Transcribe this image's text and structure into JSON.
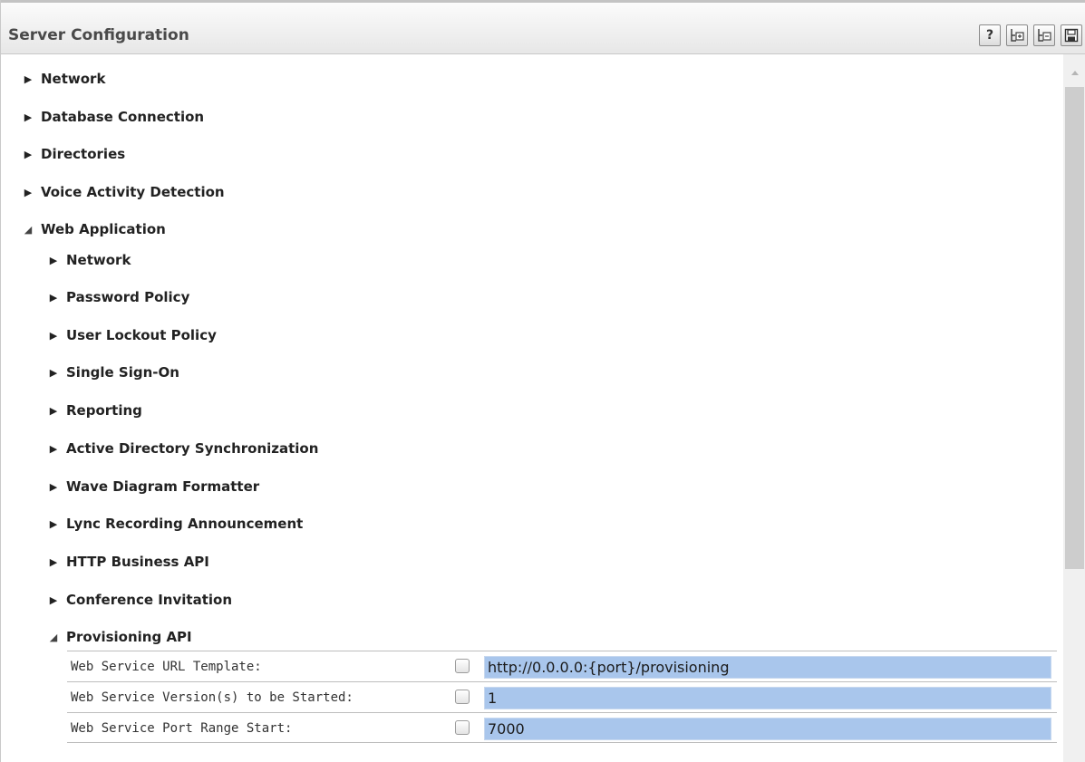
{
  "header": {
    "title": "Server Configuration",
    "buttons": [
      {
        "name": "help-button",
        "icon": "help-icon",
        "glyph": "?"
      },
      {
        "name": "expand-all-button",
        "icon": "expand-all-icon"
      },
      {
        "name": "collapse-all-button",
        "icon": "collapse-all-icon"
      },
      {
        "name": "save-button",
        "icon": "save-icon"
      }
    ]
  },
  "tree": {
    "top_level": [
      {
        "label": "Network",
        "expanded": false
      },
      {
        "label": "Database Connection",
        "expanded": false
      },
      {
        "label": "Directories",
        "expanded": false
      },
      {
        "label": "Voice Activity Detection",
        "expanded": false
      },
      {
        "label": "Web Application",
        "expanded": true
      }
    ],
    "web_application_children": [
      {
        "label": "Network",
        "expanded": false
      },
      {
        "label": "Password Policy",
        "expanded": false
      },
      {
        "label": "User Lockout Policy",
        "expanded": false
      },
      {
        "label": "Single Sign-On",
        "expanded": false
      },
      {
        "label": "Reporting",
        "expanded": false
      },
      {
        "label": "Active Directory Synchronization",
        "expanded": false
      },
      {
        "label": "Wave Diagram Formatter",
        "expanded": false
      },
      {
        "label": "Lync Recording Announcement",
        "expanded": false
      },
      {
        "label": "HTTP Business API",
        "expanded": false
      },
      {
        "label": "Conference Invitation",
        "expanded": false
      },
      {
        "label": "Provisioning API",
        "expanded": true
      }
    ]
  },
  "provisioning_api": {
    "properties": [
      {
        "label": "Web Service URL Template:",
        "checked": false,
        "value": "http://0.0.0.0:{port}/provisioning"
      },
      {
        "label": "Web Service Version(s) to be Started:",
        "checked": false,
        "value": "1"
      },
      {
        "label": "Web Service Port Range Start:",
        "checked": false,
        "value": "7000"
      }
    ]
  },
  "colors": {
    "value_background": "#a9c6ec",
    "header_background": "#ececec",
    "scroll_thumb": "#cdcdcd"
  }
}
